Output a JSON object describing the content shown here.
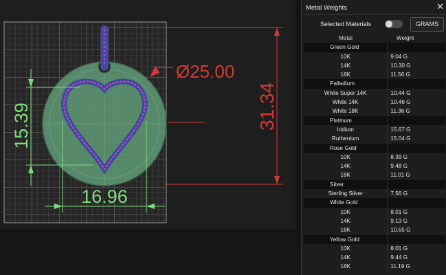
{
  "viewport": {
    "dimensions": {
      "height": "31.34",
      "diameter": "Ø25.00",
      "heart_height": "15.39",
      "heart_width": "16.96"
    }
  },
  "panel": {
    "title": "Metal Weights",
    "selected_materials_label": "Selected Materials",
    "units_button": "GRAMS",
    "columns": [
      "Metal",
      "Weight"
    ],
    "groups": [
      {
        "name": "Green Gold",
        "items": [
          {
            "metal": "10K",
            "weight": "9.04 G"
          },
          {
            "metal": "14K",
            "weight": "10.30 G"
          },
          {
            "metal": "18K",
            "weight": "11.56 G"
          }
        ]
      },
      {
        "name": "Palladium",
        "items": [
          {
            "metal": "White Super 14K",
            "weight": "10.44 G"
          },
          {
            "metal": "White 14K",
            "weight": "10.46 G"
          },
          {
            "metal": "White 18K",
            "weight": "11.36 G"
          }
        ]
      },
      {
        "name": "Platinum",
        "items": [
          {
            "metal": "Iridium",
            "weight": "15.67 G"
          },
          {
            "metal": "Ruthenium",
            "weight": "15.04 G"
          }
        ]
      },
      {
        "name": "Rose Gold",
        "items": [
          {
            "metal": "10K",
            "weight": "8.39 G"
          },
          {
            "metal": "14K",
            "weight": "9.48 G"
          },
          {
            "metal": "18K",
            "weight": "11.01 G"
          }
        ]
      },
      {
        "name": "Silver",
        "items": [
          {
            "metal": "Sterling Silver",
            "weight": "7.56 G"
          }
        ]
      },
      {
        "name": "White Gold",
        "items": [
          {
            "metal": "10K",
            "weight": "8.01 G"
          },
          {
            "metal": "14K",
            "weight": "9.13 G"
          },
          {
            "metal": "18K",
            "weight": "10.65 G"
          }
        ]
      },
      {
        "name": "Yellow Gold",
        "items": [
          {
            "metal": "10K",
            "weight": "8.01 G"
          },
          {
            "metal": "14K",
            "weight": "9.44 G"
          },
          {
            "metal": "18K",
            "weight": "11.19 G"
          }
        ]
      }
    ]
  }
}
